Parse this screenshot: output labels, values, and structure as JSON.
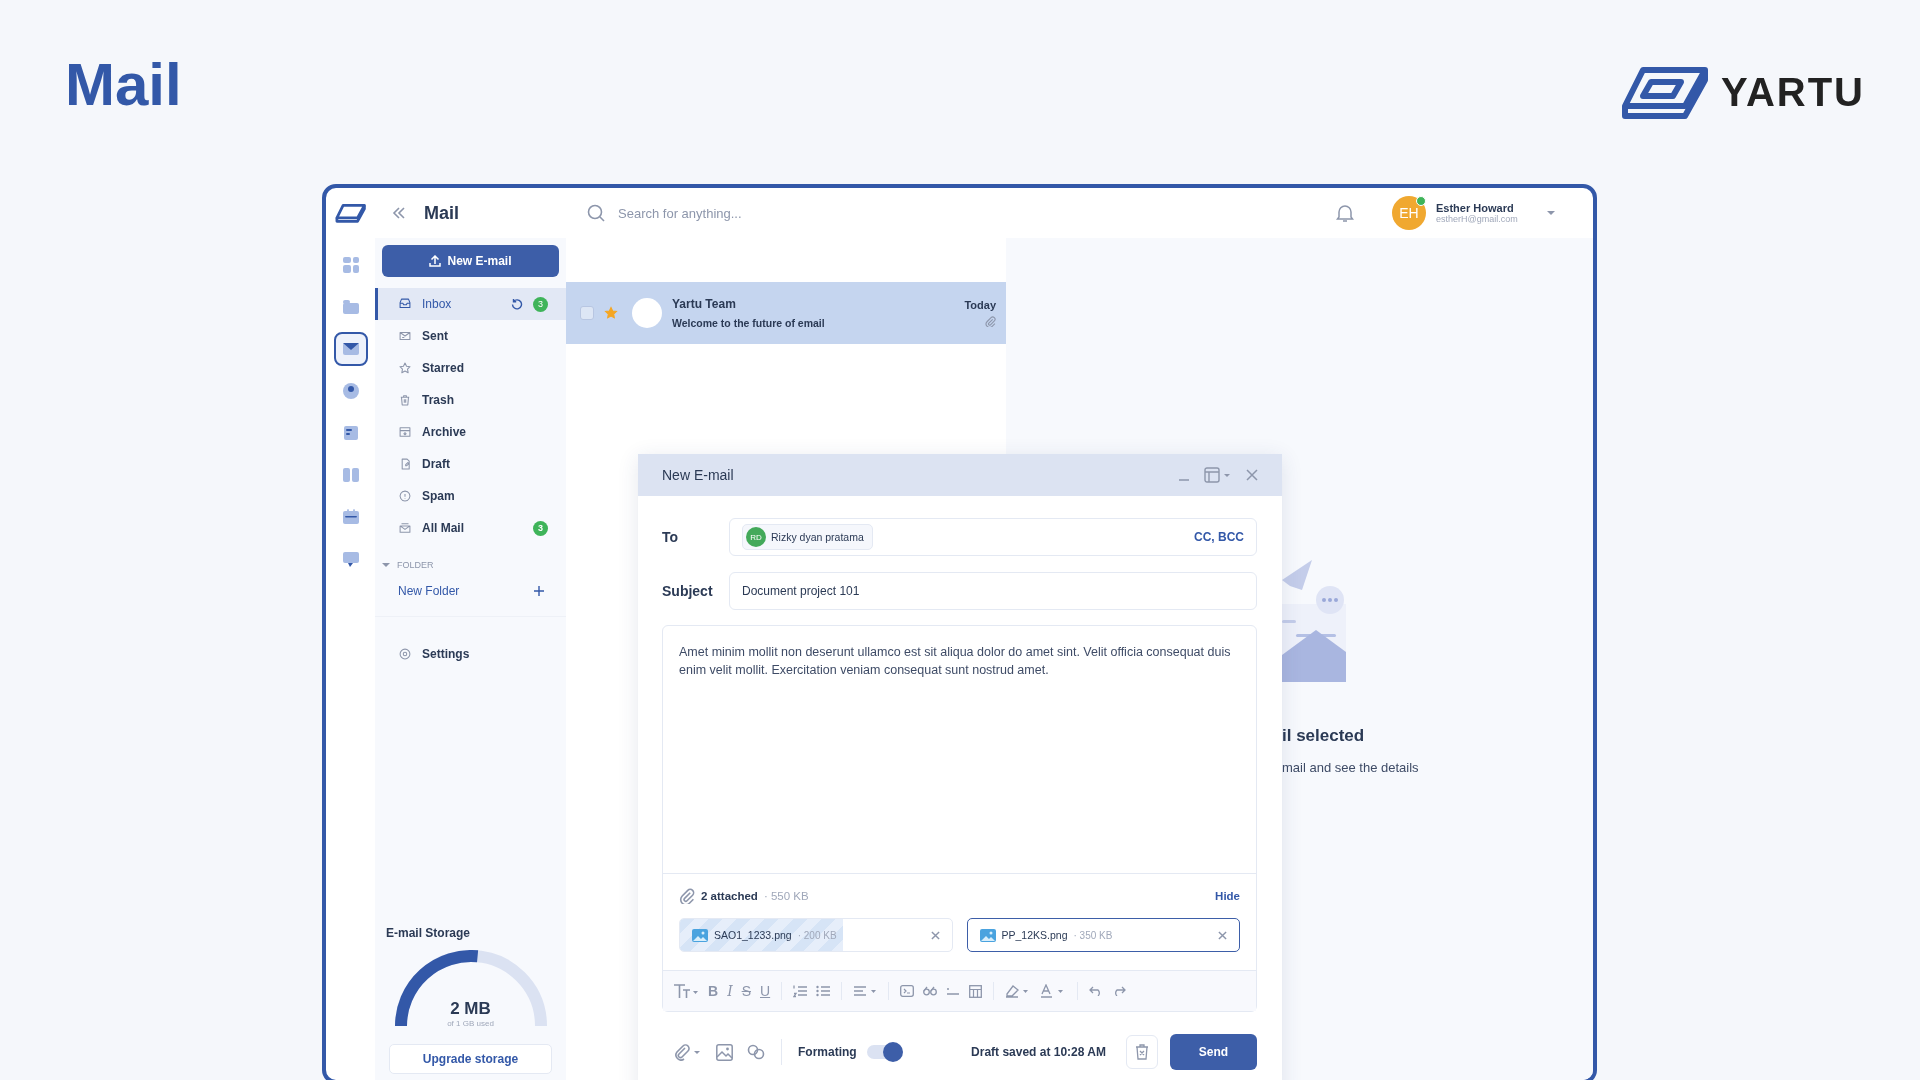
{
  "page_title": "Mail",
  "brand": {
    "name": "YARTU"
  },
  "app": {
    "title": "Mail",
    "search": {
      "placeholder": "Search for anything..."
    },
    "user": {
      "initials": "EH",
      "name": "Esther Howard",
      "email": "estherH@gmail.com",
      "online": true
    }
  },
  "rail": [
    {
      "kind": "dashboard",
      "selected": false
    },
    {
      "kind": "folder",
      "selected": false
    },
    {
      "kind": "mail",
      "selected": true
    },
    {
      "kind": "contacts",
      "selected": false
    },
    {
      "kind": "notes",
      "selected": false
    },
    {
      "kind": "board",
      "selected": false
    },
    {
      "kind": "calendar",
      "selected": false
    },
    {
      "kind": "chat",
      "selected": false
    }
  ],
  "sidebar": {
    "new_button": "New E-mail",
    "items": [
      {
        "label": "Inbox",
        "kind": "inbox",
        "selected": true,
        "refresh": true,
        "badge": "3"
      },
      {
        "label": "Sent",
        "kind": "sent",
        "selected": false
      },
      {
        "label": "Starred",
        "kind": "star",
        "selected": false
      },
      {
        "label": "Trash",
        "kind": "trash",
        "selected": false
      },
      {
        "label": "Archive",
        "kind": "archive",
        "selected": false
      },
      {
        "label": "Draft",
        "kind": "draft",
        "selected": false
      },
      {
        "label": "Spam",
        "kind": "spam",
        "selected": false
      },
      {
        "label": "All Mail",
        "kind": "allmail",
        "selected": false,
        "badge": "3"
      }
    ],
    "folder_heading": "FOLDER",
    "folder_expanded": true,
    "new_folder": "New Folder",
    "settings": "Settings",
    "storage": {
      "title": "E-mail Storage",
      "used": "2 MB",
      "caption": "of 1 GB used",
      "level": 0.53,
      "button": "Upgrade storage"
    }
  },
  "emails": [
    {
      "sender": "Yartu Team",
      "subject": "Welcome to the future of email",
      "date": "Today",
      "starred": true,
      "checked": false,
      "selected": true,
      "attachment": true
    }
  ],
  "detail": {
    "title": "il selected",
    "hint": "mail and see the details"
  },
  "compose": {
    "title": "New E-mail",
    "to_label": "To",
    "recipients": [
      {
        "initials": "RD",
        "name": "Rizky dyan pratama"
      }
    ],
    "cc_bcc": "CC, BCC",
    "subject_label": "Subject",
    "subject": "Document project 101",
    "body": "Amet minim mollit non deserunt ullamco est sit aliqua dolor do amet sint. Velit officia consequat duis enim velit mollit. Exercitation veniam consequat sunt nostrud amet.",
    "attachments_summary": {
      "count": "2 attached",
      "size": "· 550 KB",
      "hide": "Hide"
    },
    "attachments": [
      {
        "name": "SAO1_1233.png",
        "size": "· 200 KB",
        "kind": "uploading",
        "level": 0.6,
        "selected": false
      },
      {
        "name": "PP_12KS.png",
        "size": "· 350 KB",
        "kind": "done",
        "selected": true
      }
    ],
    "format_letters": [
      "B",
      "I",
      "S",
      "U"
    ],
    "formatting": {
      "label": "Formating",
      "on": true
    },
    "draft_status": "Draft saved at 10:28 AM",
    "send": "Send"
  }
}
